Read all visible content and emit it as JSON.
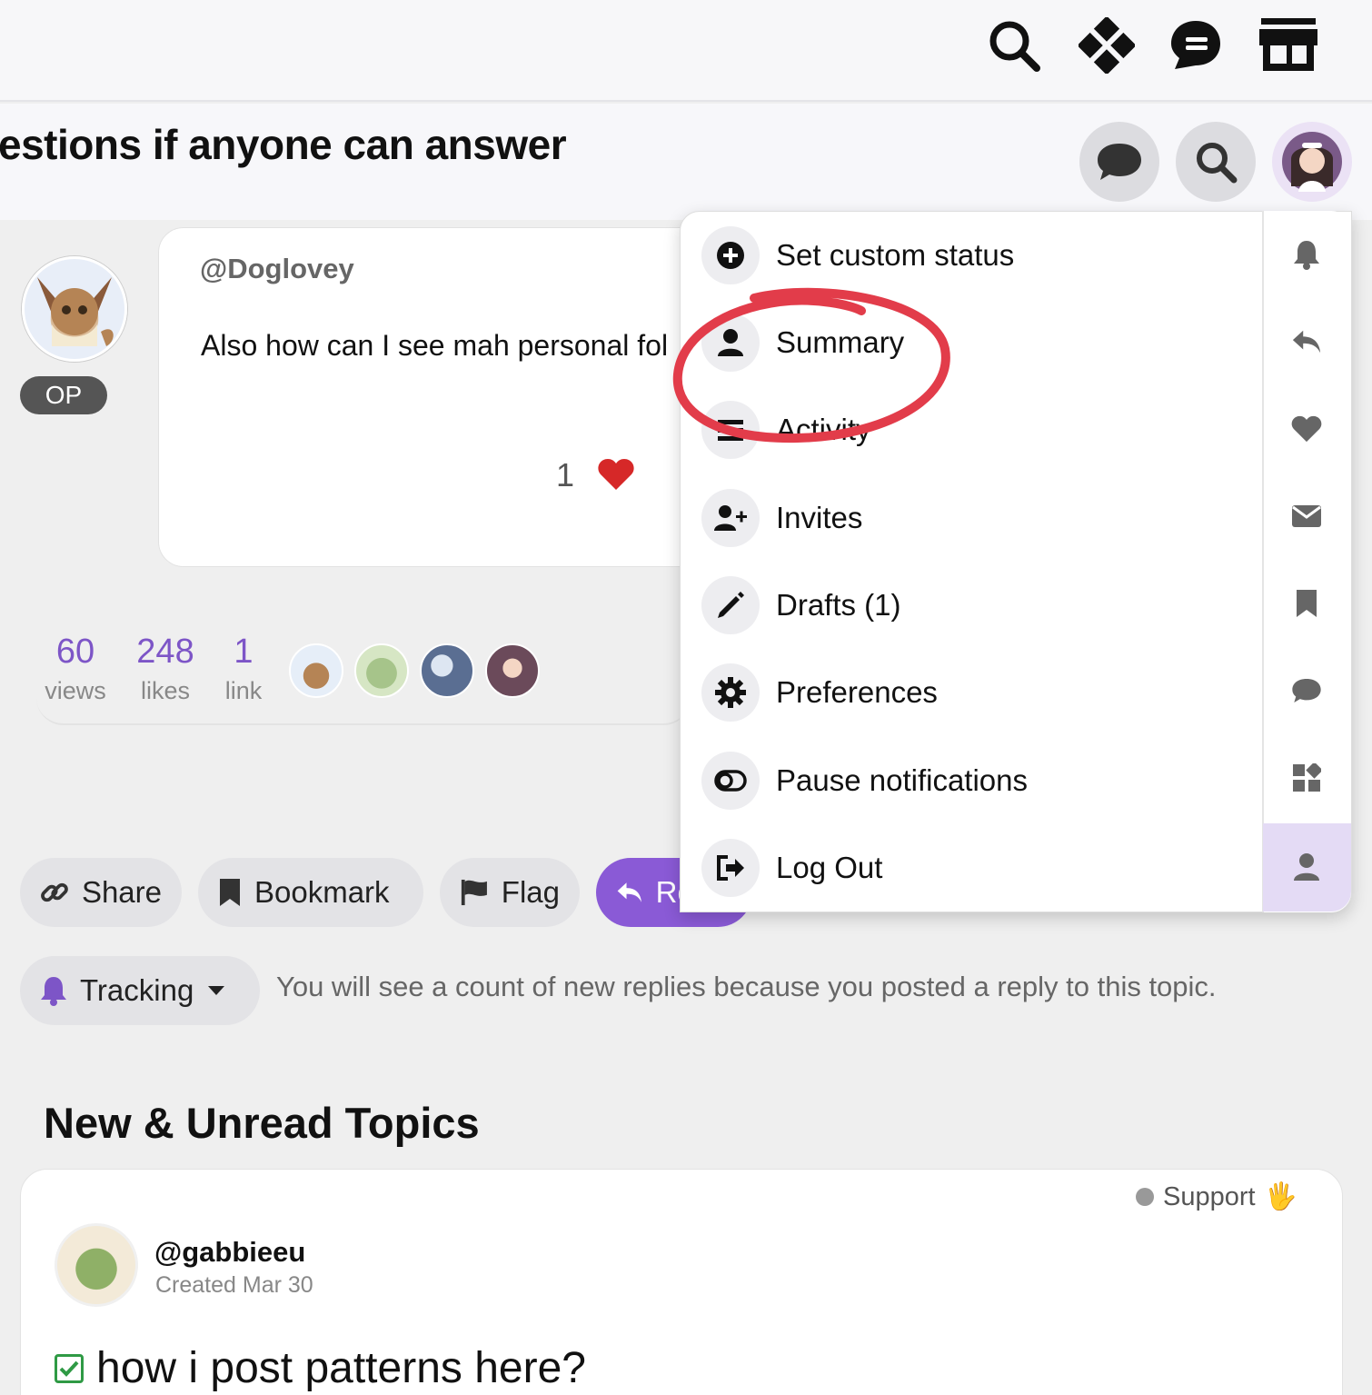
{
  "topbar": {
    "icons": [
      "search-icon",
      "diamond-grid-icon",
      "chat-bubble-icon",
      "store-icon"
    ]
  },
  "topic": {
    "title": "estions if anyone can answer"
  },
  "header_buttons": [
    "chat-icon",
    "search-icon",
    "user-avatar"
  ],
  "post": {
    "author": "@Doglovey",
    "op_badge": "OP",
    "body": "Also how can I see mah personal fol",
    "like_count": "1"
  },
  "stats": [
    {
      "value": "60",
      "label": "views"
    },
    {
      "value": "248",
      "label": "likes"
    },
    {
      "value": "1",
      "label": "link"
    }
  ],
  "actions": {
    "share": "Share",
    "bookmark": "Bookmark",
    "flag": "Flag",
    "reply": "Reply"
  },
  "tracking": {
    "label": "Tracking",
    "description": "You will see a count of new replies because you posted a reply to this topic."
  },
  "user_menu": {
    "items": [
      {
        "label": "Set custom status",
        "icon": "plus-circle-icon"
      },
      {
        "label": "Summary",
        "icon": "user-icon"
      },
      {
        "label": "Activity",
        "icon": "stream-icon"
      },
      {
        "label": "Invites",
        "icon": "user-plus-icon"
      },
      {
        "label": "Drafts (1)",
        "icon": "pencil-icon"
      },
      {
        "label": "Preferences",
        "icon": "gear-icon"
      },
      {
        "label": "Pause notifications",
        "icon": "toggle-icon"
      },
      {
        "label": "Log Out",
        "icon": "sign-out-icon"
      }
    ],
    "rail": [
      "bell-icon",
      "reply-icon",
      "heart-icon",
      "envelope-icon",
      "bookmark-icon",
      "chat-icon",
      "shapes-icon",
      "user-icon"
    ]
  },
  "new_unread": {
    "heading": "New & Unread Topics",
    "topic": {
      "category": "Support",
      "category_emoji": "🖐",
      "author": "@gabbieeu",
      "created": "Created Mar 30",
      "title": "how i post patterns here?"
    }
  },
  "colors": {
    "accent": "#8a5ad6",
    "stat_number": "#7d55c7",
    "heart": "#d62828",
    "annotation": "#e23c4a"
  }
}
